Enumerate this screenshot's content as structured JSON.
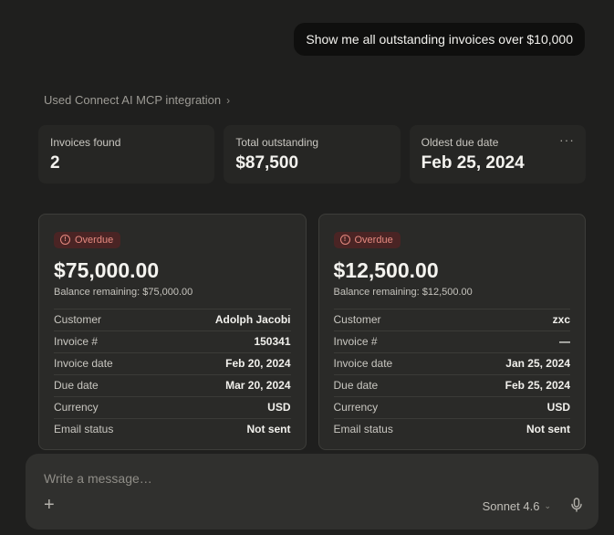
{
  "user_message": "Show me all outstanding invoices over $10,000",
  "mcp_integration": "Used Connect AI MCP integration",
  "stats": [
    {
      "label": "Invoices found",
      "value": "2"
    },
    {
      "label": "Total outstanding",
      "value": "$87,500"
    },
    {
      "label": "Oldest due date",
      "value": "Feb 25, 2024"
    }
  ],
  "invoices": [
    {
      "status": "Overdue",
      "amount": "$75,000.00",
      "balance": "Balance remaining: $75,000.00",
      "rows": [
        {
          "k": "Customer",
          "v": "Adolph Jacobi"
        },
        {
          "k": "Invoice #",
          "v": "150341"
        },
        {
          "k": "Invoice date",
          "v": "Feb 20, 2024"
        },
        {
          "k": "Due date",
          "v": "Mar 20, 2024"
        },
        {
          "k": "Currency",
          "v": "USD"
        },
        {
          "k": "Email status",
          "v": "Not sent"
        }
      ]
    },
    {
      "status": "Overdue",
      "amount": "$12,500.00",
      "balance": "Balance remaining: $12,500.00",
      "rows": [
        {
          "k": "Customer",
          "v": "zxc"
        },
        {
          "k": "Invoice #",
          "v": "—"
        },
        {
          "k": "Invoice date",
          "v": "Jan 25, 2024"
        },
        {
          "k": "Due date",
          "v": "Feb 25, 2024"
        },
        {
          "k": "Currency",
          "v": "USD"
        },
        {
          "k": "Email status",
          "v": "Not sent"
        }
      ]
    }
  ],
  "composer": {
    "placeholder": "Write a message…",
    "model": "Sonnet 4.6"
  },
  "colors": {
    "background": "#1f1f1e",
    "card": "#2a2a28",
    "overdue_badge_bg": "#4a2424",
    "overdue_badge_text": "#e68a80"
  }
}
